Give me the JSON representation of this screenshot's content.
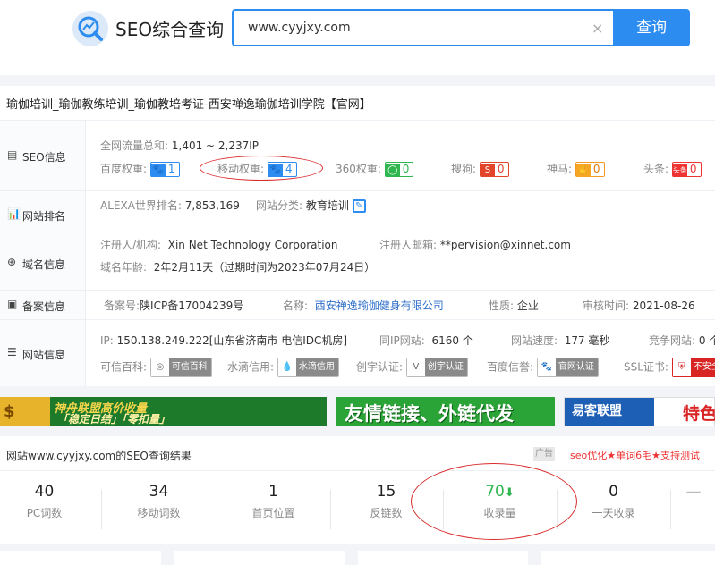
{
  "header": {
    "logo_text": "SEO综合查询",
    "search_value": "www.cyyjxy.com",
    "clear_symbol": "×",
    "search_button": "查询"
  },
  "site_title": "瑜伽培训_瑜伽教练培训_瑜伽教培考证-西安禅逸瑜伽培训学院【官网】",
  "seo_info": {
    "heading": "SEO信息",
    "traffic_label": "全网流量总和:",
    "traffic_value": "1,401 ~ 2,237IP",
    "weights": [
      {
        "label": "百度权重:",
        "value": "1"
      },
      {
        "label": "移动权重:",
        "value": "4"
      },
      {
        "label": "360权重:",
        "value": "0"
      },
      {
        "label": "搜狗:",
        "value": "0"
      },
      {
        "label": "神马:",
        "value": "0"
      },
      {
        "label": "头条:",
        "value": "0",
        "icon_text": "头条"
      }
    ]
  },
  "ranking": {
    "heading": "网站排名",
    "alexa_label": "ALEXA世界排名:",
    "alexa_value": "7,853,169",
    "category_label": "网站分类:",
    "category_value": "教育培训"
  },
  "domain": {
    "heading": "域名信息",
    "registrant_label": "注册人/机构:",
    "registrant_value": "Xin Net Technology Corporation",
    "email_label": "注册人邮箱:",
    "email_value": "**pervision@xinnet.com",
    "age_label": "域名年龄:",
    "age_value": "2年2月11天（过期时间为2023年07月24日）"
  },
  "icp": {
    "heading": "备案信息",
    "number_label": "备案号:",
    "number_value": "陕ICP备17004239号",
    "name_label": "名称:",
    "name_value": "西安禅逸瑜伽健身有限公司",
    "nature_label": "性质:",
    "nature_value": "企业",
    "audit_label": "审核时间:",
    "audit_value": "2021-08-26"
  },
  "website": {
    "heading": "网站信息",
    "ip_label": "IP:",
    "ip_value": "150.138.249.222[山东省济南市 电信IDC机房]",
    "sameip_label": "同IP网站:",
    "sameip_value": "6160 个",
    "speed_label": "网站速度:",
    "speed_value": "177 毫秒",
    "compete_label": "竞争网站:",
    "compete_value": "0 个",
    "certs": [
      {
        "label": "可信百科:",
        "badge": "可信百科"
      },
      {
        "label": "水滴信用:",
        "badge": "水滴信用"
      },
      {
        "label": "创宇认证:",
        "badge": "创宇认证"
      },
      {
        "label": "百度信誉:",
        "badge": "官网认证"
      },
      {
        "label": "SSL证书:",
        "badge": "不安全"
      }
    ]
  },
  "banners": {
    "b1_line1": "神舟联盟高价收量",
    "b1_line2": "「稳定日结」「零扣量」",
    "b1_coin": "$",
    "b2_text": "友情链接、外链代发",
    "b3_logo": "易客联盟",
    "b3_text": "特色"
  },
  "results": {
    "title": "网站www.cyyjxy.com的SEO查询结果",
    "ad_tag": "广告",
    "ad_text": "seo优化★单词6毛★支持测试",
    "stats": [
      {
        "num": "40",
        "label": "PC词数"
      },
      {
        "num": "34",
        "label": "移动词数"
      },
      {
        "num": "1",
        "label": "首页位置"
      },
      {
        "num": "15",
        "label": "反链数"
      },
      {
        "num": "70",
        "label": "收录量"
      },
      {
        "num": "0",
        "label": "一天收录"
      },
      {
        "num": "—",
        "label": ""
      }
    ]
  },
  "colors": {
    "primary": "#2d8cf0",
    "annotation_red": "#d92b2b",
    "green": "#2fb64e"
  }
}
